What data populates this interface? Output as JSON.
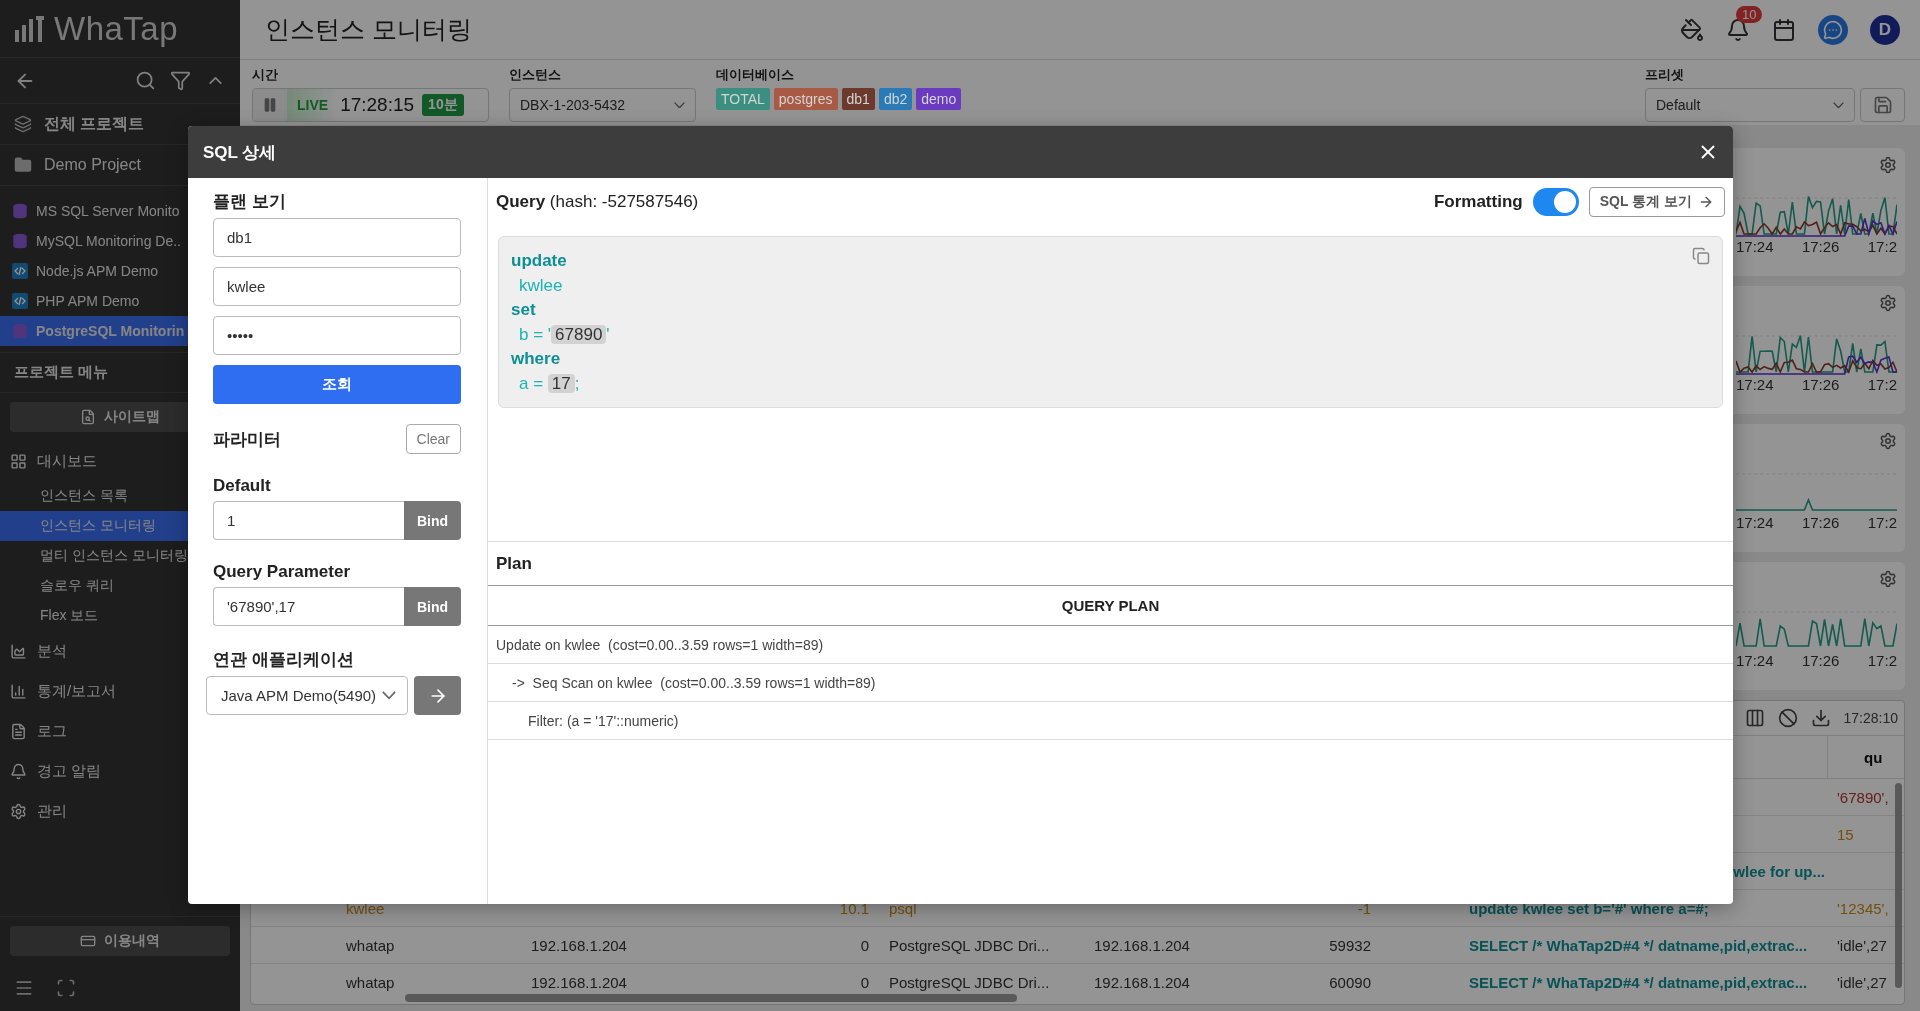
{
  "sidebar": {
    "logo": "WhaTap",
    "all_projects": "전체 프로젝트",
    "group": "Demo Project",
    "projects": [
      {
        "name": "MS SQL Server Monito",
        "kind": "database",
        "selected": false
      },
      {
        "name": "MySQL Monitoring De..",
        "kind": "database",
        "selected": false
      },
      {
        "name": "Node.js APM Demo",
        "kind": "code",
        "selected": false
      },
      {
        "name": "PHP APM Demo",
        "kind": "code",
        "selected": false
      },
      {
        "name": "PostgreSQL Monitorin",
        "kind": "database",
        "selected": true
      }
    ],
    "project_menu_title": "프로젝트 메뉴",
    "sitemap_button": "사이트맵",
    "menu": [
      {
        "label": "대시보드",
        "kind": "dashboard",
        "children": [
          {
            "label": "인스턴스 목록",
            "selected": false
          },
          {
            "label": "인스턴스 모니터링",
            "selected": true
          },
          {
            "label": "멀티 인스턴스 모니터링",
            "selected": false
          },
          {
            "label": "슬로우 쿼리",
            "selected": false
          },
          {
            "label": "Flex 보드",
            "selected": false
          }
        ]
      },
      {
        "label": "분석",
        "kind": "analysis"
      },
      {
        "label": "통계/보고서",
        "kind": "stats"
      },
      {
        "label": "로그",
        "kind": "log"
      },
      {
        "label": "경고 알림",
        "kind": "alert"
      },
      {
        "label": "관리",
        "kind": "admin"
      }
    ],
    "usage_button": "이용내역"
  },
  "header": {
    "title": "인스턴스 모니터링",
    "notifications": "10",
    "avatar": "D"
  },
  "filters": {
    "time": {
      "label": "시간",
      "live": "LIVE",
      "clock": "17:28:15",
      "range": "10분"
    },
    "instance": {
      "label": "인스턴스",
      "value": "DBX-1-203-5432"
    },
    "database": {
      "label": "데이터베이스",
      "tags": [
        {
          "text": "TOTAL",
          "color": "#3a8f80"
        },
        {
          "text": "postgres",
          "color": "#a85a45"
        },
        {
          "text": "db1",
          "color": "#6b3a2c"
        },
        {
          "text": "db2",
          "color": "#2a7ab8"
        },
        {
          "text": "demo",
          "color": "#6a3ac0"
        }
      ]
    },
    "preset": {
      "label": "프리셋",
      "value": "Default"
    }
  },
  "charts": [
    {
      "kind": "multi",
      "ticks": [
        "17:24",
        "17:26",
        "17:2"
      ]
    },
    {
      "kind": "multi",
      "ticks": [
        "17:24",
        "17:26",
        "17:2"
      ]
    },
    {
      "kind": "flat",
      "ticks": [
        "17:24",
        "17:26",
        "17:2"
      ]
    },
    {
      "kind": "single",
      "ticks": [
        "17:24",
        "17:26",
        "17:2"
      ]
    }
  ],
  "table": {
    "updated": "17:28:10",
    "last_column_heading": "qu",
    "rows": [
      {
        "kind": "error",
        "column_8": "'67890',"
      },
      {
        "kind": "warning",
        "column_8": "15"
      },
      {
        "cut_left": true,
        "column_7": "wlee for up..."
      },
      {
        "kind": "warning",
        "cut_left": false,
        "column_1": "kwlee",
        "column_3": "10.1",
        "column_4": "psql",
        "column_6": "-1",
        "column_7": "update kwlee set b='#' where a=#;",
        "column_8": "'12345',"
      },
      {
        "kind": "normal",
        "cut_left": false,
        "column_1": "whatap",
        "column_2": "192.168.1.204",
        "column_3": "0",
        "column_4": "PostgreSQL JDBC Dri...",
        "column_5": "192.168.1.204",
        "column_6": "59932",
        "column_7": "SELECT /* WhaTap2D#4 */ datname,pid,extrac...",
        "column_8": "'idle',27"
      },
      {
        "kind": "normal",
        "cut_left": false,
        "column_1": "whatap",
        "column_2": "192.168.1.204",
        "column_3": "0",
        "column_4": "PostgreSQL JDBC Dri...",
        "column_5": "192.168.1.204",
        "column_6": "60090",
        "column_7": "SELECT /* WhaTap2D#4 */ datname,pid,extrac...",
        "column_8": "'idle',27"
      }
    ]
  },
  "modal": {
    "title": "SQL 상세",
    "plan_form": {
      "title": "플랜 보기",
      "fields": [
        {
          "value": "db1"
        },
        {
          "value": "kwlee"
        },
        {
          "value": "•••••"
        }
      ],
      "submit": "조회"
    },
    "parameters": {
      "title": "파라미터",
      "clear": "Clear",
      "groups": [
        {
          "label": "Default",
          "value": "1",
          "button": "Bind"
        },
        {
          "label": "Query Parameter",
          "value": "'67890',17",
          "button": "Bind"
        }
      ]
    },
    "related_app": {
      "label": "연관 애플리케이션",
      "value": "Java APM Demo(5490)"
    },
    "query": {
      "heading": "**Query** (hash: -527587546)",
      "formatting_label": "Formatting",
      "formatting": {
        "on": true
      },
      "stats_button": "SQL 통계 보기",
      "clauses": [
        {
          "keyword": "update",
          "body": [
            [
              {
                "kind": "ident",
                "text": "kwlee"
              }
            ]
          ]
        },
        {
          "keyword": "set",
          "body": [
            [
              {
                "kind": "ident",
                "text": "b = '"
              },
              {
                "kind": "value",
                "text": "67890"
              },
              {
                "kind": "ident",
                "text": "'"
              }
            ]
          ]
        },
        {
          "keyword": "where",
          "body": [
            [
              {
                "kind": "ident",
                "text": "a = "
              },
              {
                "kind": "value",
                "text": "17"
              },
              {
                "kind": "ident",
                "text": ";"
              }
            ]
          ]
        }
      ]
    },
    "plan": {
      "title": "Plan",
      "column": "QUERY PLAN",
      "rows": [
        {
          "text": "Update on kwlee  (cost=0.00..3.59 rows=1 width=89)",
          "children": [
            {
              "text": "->  Seq Scan on kwlee  (cost=0.00..3.59 rows=1 width=89)",
              "children": [
                {
                  "text": "Filter: (a = '17'::numeric)"
                }
              ]
            }
          ]
        }
      ]
    }
  }
}
